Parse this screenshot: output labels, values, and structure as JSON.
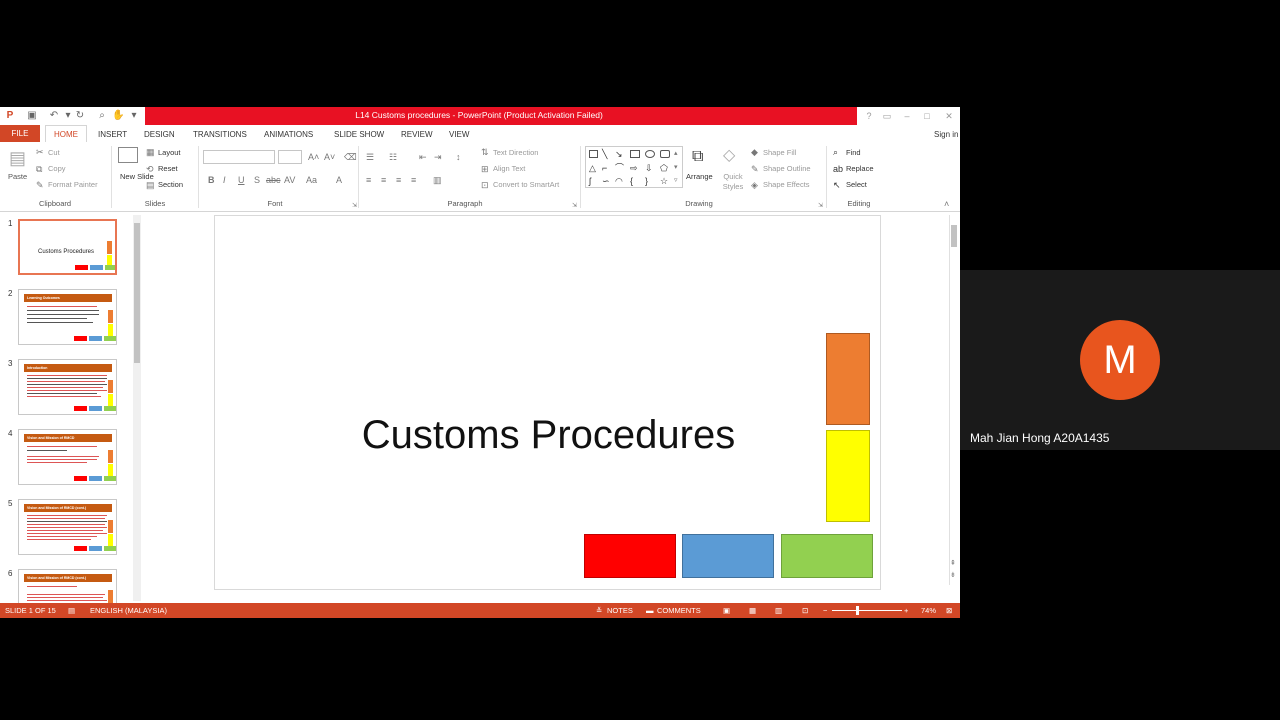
{
  "window": {
    "title": "L14 Customs procedures - PowerPoint (Product Activation Failed)",
    "sign_in": "Sign in"
  },
  "tabs": [
    "FILE",
    "HOME",
    "INSERT",
    "DESIGN",
    "TRANSITIONS",
    "ANIMATIONS",
    "SLIDE SHOW",
    "REVIEW",
    "VIEW"
  ],
  "active_tab": "HOME",
  "ribbon": {
    "clipboard": {
      "paste": "Paste",
      "cut": "Cut",
      "copy": "Copy",
      "format_painter": "Format Painter",
      "group": "Clipboard"
    },
    "slides": {
      "new_slide": "New Slide",
      "layout": "Layout",
      "reset": "Reset",
      "section": "Section",
      "group": "Slides"
    },
    "font": {
      "group": "Font"
    },
    "paragraph": {
      "text_direction": "Text Direction",
      "align_text": "Align Text",
      "convert_smartart": "Convert to SmartArt",
      "group": "Paragraph"
    },
    "drawing": {
      "arrange": "Arrange",
      "quick_styles": "Quick Styles",
      "shape_fill": "Shape Fill",
      "shape_outline": "Shape Outline",
      "shape_effects": "Shape Effects",
      "group": "Drawing"
    },
    "editing": {
      "find": "Find",
      "replace": "Replace",
      "select": "Select",
      "group": "Editing"
    }
  },
  "thumbnails": [
    {
      "num": "1",
      "title": "Customs Procedures"
    },
    {
      "num": "2",
      "title": "Learning Outcomes"
    },
    {
      "num": "3",
      "title": "Introduction"
    },
    {
      "num": "4",
      "title": "Vision and Mission of RMCD"
    },
    {
      "num": "5",
      "title": "Vision and Mission of RMCD (cont.)"
    },
    {
      "num": "6",
      "title": "Vision and Mission of RMCD (cont.)"
    }
  ],
  "slide": {
    "title": "Customs Procedures"
  },
  "status": {
    "slide_info": "SLIDE 1 OF 15",
    "language": "ENGLISH (MALAYSIA)",
    "notes": "NOTES",
    "comments": "COMMENTS",
    "zoom": "74%"
  },
  "participant": {
    "initial": "M",
    "name": "Mah Jian Hong A20A1435"
  },
  "colors": {
    "accent": "#d24726",
    "title_red": "#e81123",
    "orange": "#ed7d31",
    "yellow": "#ffff00",
    "red": "#ff0000",
    "blue": "#5b9bd5",
    "green": "#92d050",
    "avatar": "#e8551e"
  }
}
